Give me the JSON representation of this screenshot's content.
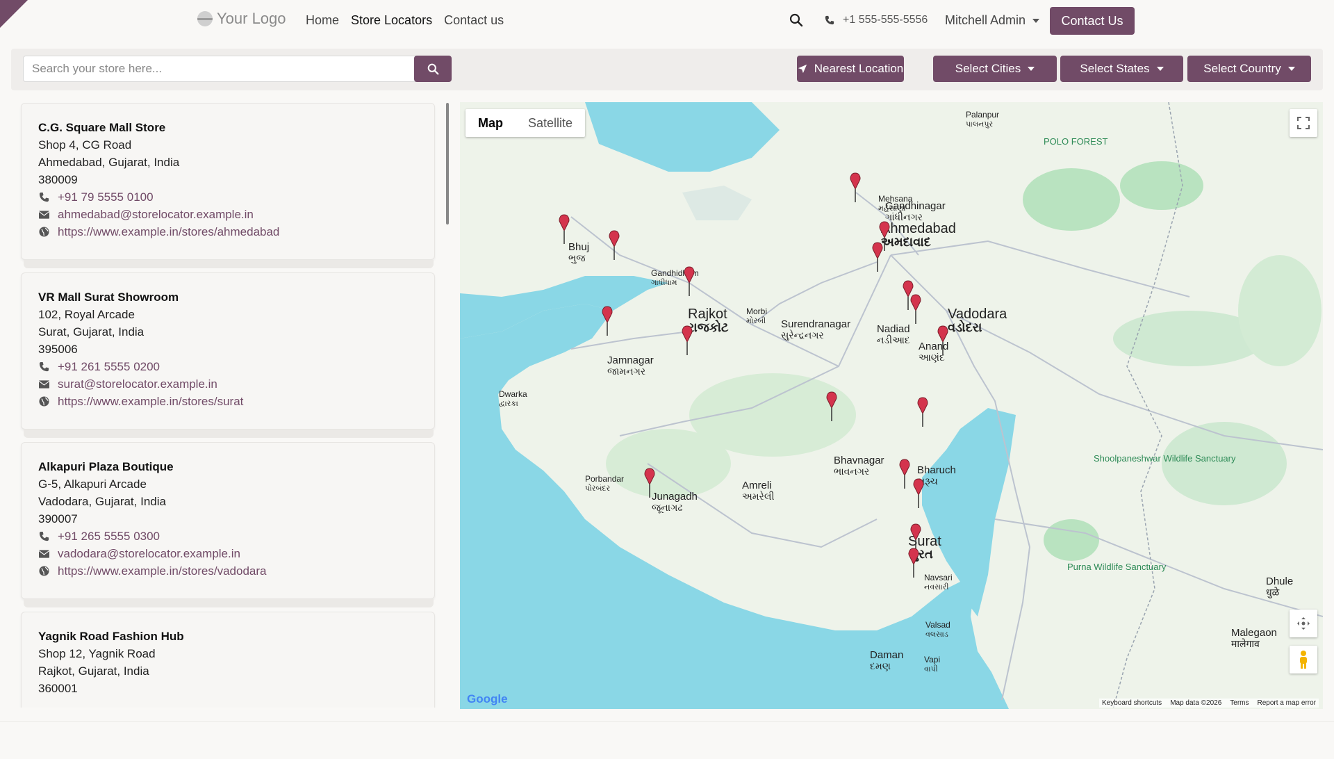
{
  "header": {
    "logo_text": "Your Logo",
    "nav": [
      {
        "label": "Home",
        "active": false
      },
      {
        "label": "Store Locators",
        "active": true
      },
      {
        "label": "Contact us",
        "active": false
      }
    ],
    "phone": "+1 555-555-5556",
    "user": "Mitchell Admin",
    "contact_button": "Contact Us"
  },
  "toolbar": {
    "search_placeholder": "Search your store here...",
    "nearest_label": "Nearest Location",
    "cities_label": "Select Cities",
    "states_label": "Select States",
    "country_label": "Select Country"
  },
  "stores": [
    {
      "name": "C.G. Square Mall Store",
      "address1": "Shop 4, CG Road",
      "address2": "Ahmedabad, Gujarat, India",
      "zip": "380009",
      "phone": "+91 79 5555 0100",
      "email": "ahmedabad@storelocator.example.in",
      "url": "https://www.example.in/stores/ahmedabad"
    },
    {
      "name": "VR Mall Surat Showroom",
      "address1": "102, Royal Arcade",
      "address2": "Surat, Gujarat, India",
      "zip": "395006",
      "phone": "+91 261 5555 0200",
      "email": "surat@storelocator.example.in",
      "url": "https://www.example.in/stores/surat"
    },
    {
      "name": "Alkapuri Plaza Boutique",
      "address1": "G-5, Alkapuri Arcade",
      "address2": "Vadodara, Gujarat, India",
      "zip": "390007",
      "phone": "+91 265 5555 0300",
      "email": "vadodara@storelocator.example.in",
      "url": "https://www.example.in/stores/vadodara"
    },
    {
      "name": "Yagnik Road Fashion Hub",
      "address1": "Shop 12, Yagnik Road",
      "address2": "Rajkot, Gujarat, India",
      "zip": "360001",
      "phone": "",
      "email": "",
      "url": ""
    }
  ],
  "map": {
    "tab_map": "Map",
    "tab_satellite": "Satellite",
    "google_label": "Google",
    "footer": [
      "Keyboard shortcuts",
      "Map data ©2026",
      "Terms",
      "Report a map error"
    ],
    "cities": [
      {
        "name": "Ahmedabad",
        "local": "અમદાવાદ"
      },
      {
        "name": "Gandhinagar",
        "local": "ગાંધીનગર"
      },
      {
        "name": "Rajkot",
        "local": "રાજકોટ"
      },
      {
        "name": "Vadodara",
        "local": "વડોદરા"
      },
      {
        "name": "Surat",
        "local": "સુરત"
      },
      {
        "name": "Bhavnagar",
        "local": "ભાવનગર"
      },
      {
        "name": "Jamnagar",
        "local": "જામનગર"
      },
      {
        "name": "Junagadh",
        "local": "જૂનાગઢ"
      },
      {
        "name": "Bhuj",
        "local": "ભુજ"
      },
      {
        "name": "Nadiad",
        "local": "નડીઆદ"
      },
      {
        "name": "Anand",
        "local": "આણંદ"
      },
      {
        "name": "Bharuch",
        "local": "ભરૂચ"
      },
      {
        "name": "Morbi",
        "local": "મોરબી"
      },
      {
        "name": "Surendranagar",
        "local": "સુરેન્દ્રનગર"
      },
      {
        "name": "Amreli",
        "local": "અમરેલી"
      },
      {
        "name": "Mehsana",
        "local": "મહેસાણા"
      },
      {
        "name": "Valsad",
        "local": "વલસાડ"
      },
      {
        "name": "Navsari",
        "local": "નવસારી"
      },
      {
        "name": "Vapi",
        "local": "વાપી"
      },
      {
        "name": "Daman",
        "local": "દમણ"
      },
      {
        "name": "Gandhidham",
        "local": "ગાંધીધામ"
      },
      {
        "name": "Dhule",
        "local": "धुळे"
      },
      {
        "name": "Malegaon",
        "local": "मालेगाव"
      },
      {
        "name": "Porbandar",
        "local": "પોરબંદર"
      },
      {
        "name": "Dwarka",
        "local": "દ્વારકા"
      },
      {
        "name": "Palanpur",
        "local": "પાલનપુર"
      },
      {
        "name": "Shoolpaneshwar Wildlife Sanctuary",
        "local": ""
      },
      {
        "name": "Purna Wildlife Sanctuary",
        "local": ""
      },
      {
        "name": "POLO FOREST",
        "local": ""
      }
    ]
  },
  "colors": {
    "brand": "#714b67",
    "water": "#8ad7e6",
    "land": "#eef3ea",
    "green": "#b9e3c0",
    "marker": "#d4344d"
  }
}
